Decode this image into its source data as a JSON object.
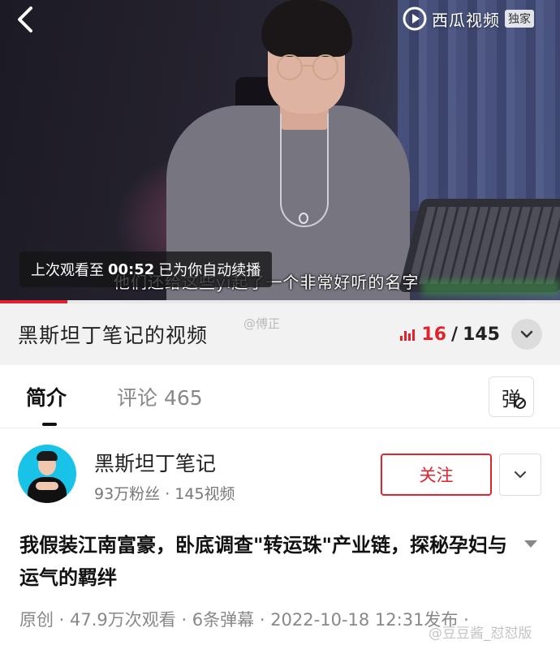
{
  "player": {
    "brand_name": "西瓜视频",
    "brand_tag": "独家",
    "subtitle": "他们还给这些yi起了一个非常好听的名字",
    "resume_prefix": "上次观看至",
    "resume_time": "00:52",
    "resume_suffix": "已为你自动续播",
    "progress_fraction": 0.12,
    "accent_color": "#e2232d"
  },
  "series": {
    "title": "黑斯坦丁笔记的视频",
    "watermark": "@傅正",
    "current_episode": "16",
    "separator": "/",
    "total_episodes": "145"
  },
  "tabs": [
    {
      "label": "简介",
      "active": true
    },
    {
      "label": "评论 465",
      "active": false
    }
  ],
  "danmaku_toggle": {
    "label": "弹",
    "icon": "danmaku-off-icon"
  },
  "author": {
    "name": "黑斯坦丁笔记",
    "stats": "93万粉丝 · 145视频",
    "follow_label": "关注"
  },
  "video": {
    "title": "我假装江南富豪，卧底调查\"转运珠\"产业链，探秘孕妇与运气的羁绊",
    "meta": "原创 · 47.9万次观看 · 6条弹幕 · 2022-10-18 12:31发布 ·",
    "watermark": "@豆豆酱_怼怼版"
  }
}
